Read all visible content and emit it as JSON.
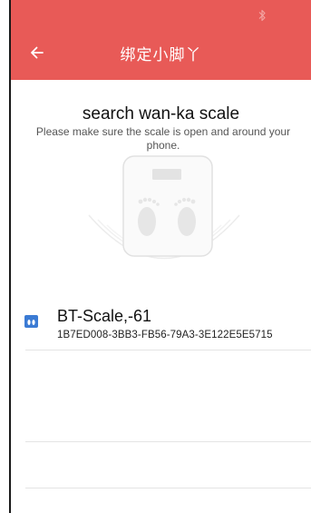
{
  "header": {
    "title": "绑定小脚丫",
    "back_icon": "arrow-left-icon",
    "background": "#e85a57"
  },
  "status_bar": {
    "bluetooth_icon": "bluetooth-icon"
  },
  "search": {
    "title": "search wan-ka scale",
    "subtitle": "Please make sure the scale is open and around your phone."
  },
  "devices": [
    {
      "name": "BT-Scale,-61",
      "uuid": "1B7ED008-3BB3-FB56-79A3-3E122E5E5715",
      "icon": "scale-device-icon",
      "icon_color": "#3b7bd4"
    }
  ]
}
